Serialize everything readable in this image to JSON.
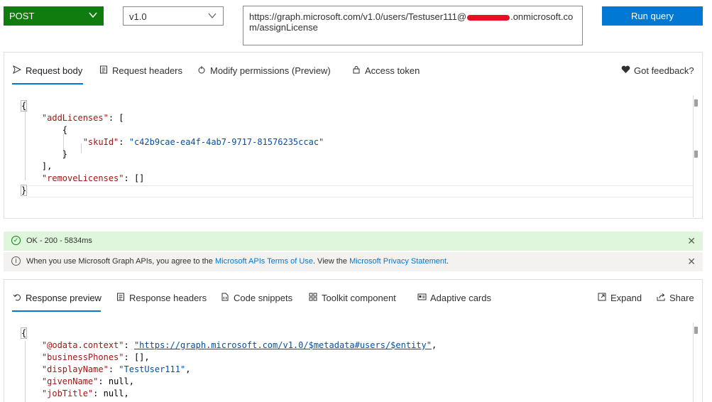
{
  "toolbar": {
    "method": "POST",
    "version": "v1.0",
    "url_part1": "https://graph.microsoft.com/v1.0/users/Testuser111@",
    "url_part2": ".onmicrosoft.com/assignLicense",
    "run_label": "Run query"
  },
  "request_tabs": {
    "body": "Request body",
    "headers": "Request headers",
    "permissions": "Modify permissions (Preview)",
    "token": "Access token",
    "feedback": "Got feedback?"
  },
  "request_code": {
    "open": "{",
    "add_key": "\"addLicenses\"",
    "add_open": ": [",
    "inner_open": "{",
    "sku_key": "\"skuId\"",
    "sku_colon": ": ",
    "sku_value": "\"c42b9cae-ea4f-4ab7-9717-81576235ccac\"",
    "inner_close": "}",
    "add_close": "],",
    "remove_key": "\"removeLicenses\"",
    "remove_value": ": []",
    "close": "}"
  },
  "status": {
    "ok_text": "OK - 200 - 5834ms",
    "info_prefix": "When you use Microsoft Graph APIs, you agree to the ",
    "info_link1": "Microsoft APIs Terms of Use",
    "info_mid": ". View the ",
    "info_link2": "Microsoft Privacy Statement",
    "info_suffix": "."
  },
  "response_tabs": {
    "preview": "Response preview",
    "headers": "Response headers",
    "snippets": "Code snippets",
    "toolkit": "Toolkit component",
    "cards": "Adaptive cards",
    "expand": "Expand",
    "share": "Share"
  },
  "response_code": {
    "open": "{",
    "context_key": "\"@odata.context\"",
    "context_value": "\"https://graph.microsoft.com/v1.0/$metadata#users/$entity\"",
    "phones_key": "\"businessPhones\"",
    "phones_value": ": [],",
    "display_key": "\"displayName\"",
    "display_value": "\"TestUser111\"",
    "given_key": "\"givenName\"",
    "given_value": ": null,",
    "job_key": "\"jobTitle\"",
    "job_value": ": null,"
  },
  "colors": {
    "method_bg": "#107c10",
    "run_bg": "#0078d4",
    "ok_bg": "#dff6dd",
    "info_bg": "#f3f2f1",
    "tab_underline": "#0078d4"
  },
  "icons": {
    "method_chevron": "chevron-down-icon",
    "version_chevron": "chevron-down-icon",
    "request_body": "send-icon",
    "request_headers": "document-icon",
    "permissions": "shield-icon",
    "token": "lock-icon",
    "feedback": "heart-icon",
    "ok": "check-circle-icon",
    "info": "info-icon",
    "close": "close-icon",
    "response_preview": "undo-arrow-icon",
    "response_headers": "document-icon",
    "snippets": "code-file-icon",
    "toolkit": "grid-icon",
    "cards": "card-icon",
    "expand": "expand-icon",
    "share": "share-icon"
  }
}
